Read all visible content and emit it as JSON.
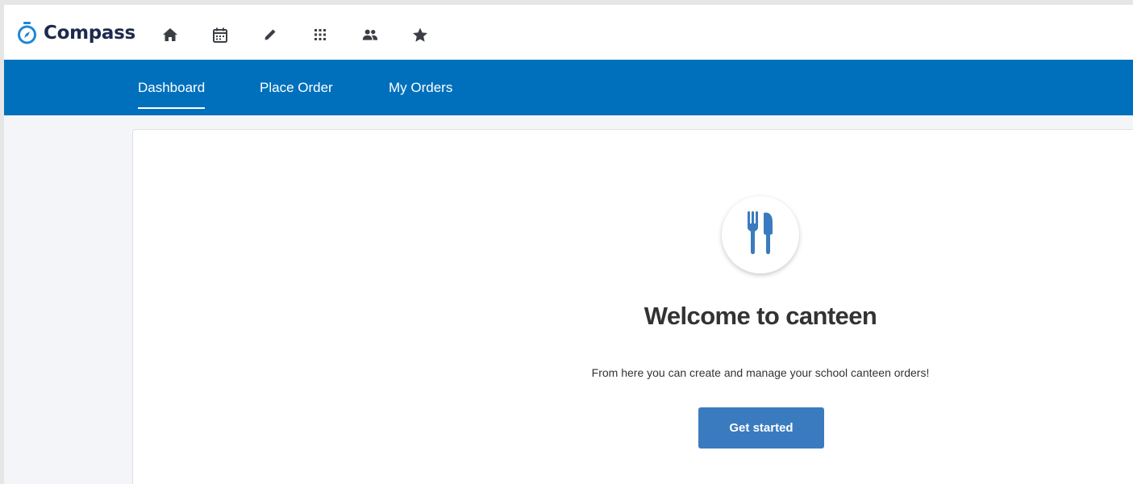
{
  "app": {
    "name": "Compass",
    "brand_color": "#1d2a4d",
    "accent_color": "#0070bc"
  },
  "toolbar": {
    "icons": [
      "home-icon",
      "calendar-icon",
      "pencil-icon",
      "apps-grid-icon",
      "people-icon",
      "star-icon"
    ]
  },
  "nav": {
    "tabs": [
      {
        "label": "Dashboard",
        "active": true
      },
      {
        "label": "Place Order",
        "active": false
      },
      {
        "label": "My Orders",
        "active": false
      }
    ]
  },
  "main": {
    "icon": "cutlery-icon",
    "title": "Welcome to canteen",
    "subtitle": "From here you can create and manage your school canteen orders!",
    "cta_label": "Get started",
    "cta_color": "#3a7bbf"
  }
}
